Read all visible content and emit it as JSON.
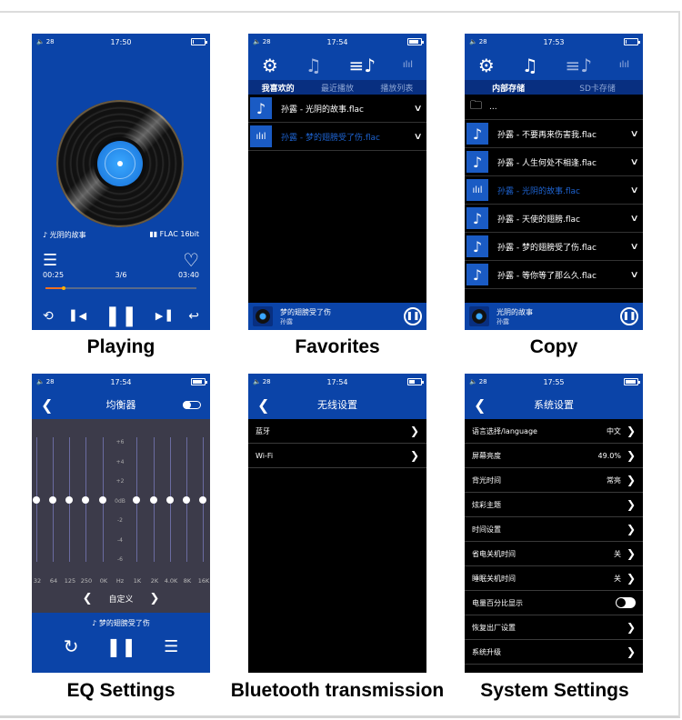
{
  "captions": [
    "Playing",
    "Favorites",
    "Copy",
    "EQ Settings",
    "Bluetooth transmission",
    "System Settings"
  ],
  "colors": {
    "primary_blue": "#0b44a8",
    "tab_bar": "#082f80",
    "progress": "#f07020",
    "active_text": "#1e63d0",
    "eq_bg": "#3c3b4a"
  },
  "playing": {
    "status": {
      "volume": "28",
      "time": "17:50",
      "battery": 0.1
    },
    "song": "光阴的故事",
    "format": "FLAC 16bit",
    "elapsed": "00:25",
    "track_pos": "3/6",
    "duration": "03:40",
    "progress": 0.12
  },
  "favorites": {
    "status": {
      "volume": "28",
      "time": "17:54",
      "battery": 0.85
    },
    "tabs": [
      "我喜欢的",
      "最近播放",
      "播放列表"
    ],
    "active_tab": 0,
    "files": [
      {
        "name": "孙露 - 光阴的故事.flac",
        "playing": false
      },
      {
        "name": "孙露 - 梦的翅膀受了伤.flac",
        "playing": true
      }
    ],
    "now_playing": {
      "title": "梦的翅膀受了伤",
      "artist": "孙露"
    }
  },
  "copy": {
    "status": {
      "volume": "28",
      "time": "17:53",
      "battery": 0.1
    },
    "tabs": [
      "内部存储",
      "SD卡存储"
    ],
    "active_tab": 0,
    "up_folder": "...",
    "files": [
      {
        "name": "孙露 - 不要再来伤害我.flac",
        "playing": false
      },
      {
        "name": "孙露 - 人生何处不相逢.flac",
        "playing": false
      },
      {
        "name": "孙露 - 光阴的故事.flac",
        "playing": true
      },
      {
        "name": "孙露 - 天使的翅膀.flac",
        "playing": false
      },
      {
        "name": "孙露 - 梦的翅膀受了伤.flac",
        "playing": false
      },
      {
        "name": "孙露 - 等你等了那么久.flac",
        "playing": false
      }
    ],
    "now_playing": {
      "title": "光阴的故事",
      "artist": "孙露"
    }
  },
  "eq": {
    "status": {
      "volume": "28",
      "time": "17:54",
      "battery": 0.85
    },
    "title": "均衡器",
    "enabled": false,
    "db_labels": [
      "+6",
      "+4",
      "+2",
      "0dB",
      "-2",
      "-4",
      "-6"
    ],
    "bands": [
      "32",
      "64",
      "125",
      "250",
      "0K",
      "1K",
      "2K",
      "4.0K",
      "8K",
      "16K"
    ],
    "hz_label": "Hz",
    "gains_db": [
      0,
      0,
      0,
      0,
      0,
      0,
      0,
      0,
      0,
      0
    ],
    "preset": "自定义",
    "song": "梦的翅膀受了伤"
  },
  "wireless": {
    "status": {
      "volume": "28",
      "time": "17:54",
      "battery": 0.5
    },
    "title": "无线设置",
    "items": [
      "蓝牙",
      "Wi-Fi"
    ]
  },
  "system": {
    "status": {
      "volume": "28",
      "time": "17:55",
      "battery": 0.95
    },
    "title": "系统设置",
    "items": [
      {
        "label": "语言选择/language",
        "value": "中文",
        "type": "arrow"
      },
      {
        "label": "屏幕亮度",
        "value": "49.0%",
        "type": "arrow"
      },
      {
        "label": "背光时间",
        "value": "常亮",
        "type": "arrow"
      },
      {
        "label": "炫彩主题",
        "value": "",
        "type": "arrow"
      },
      {
        "label": "时间设置",
        "value": "",
        "type": "arrow"
      },
      {
        "label": "省电关机时间",
        "value": "关",
        "type": "arrow"
      },
      {
        "label": "睡眠关机时间",
        "value": "关",
        "type": "arrow"
      },
      {
        "label": "电量百分比显示",
        "value": "",
        "type": "toggle"
      },
      {
        "label": "恢复出厂设置",
        "value": "",
        "type": "arrow"
      },
      {
        "label": "系统升级",
        "value": "",
        "type": "arrow"
      }
    ]
  }
}
